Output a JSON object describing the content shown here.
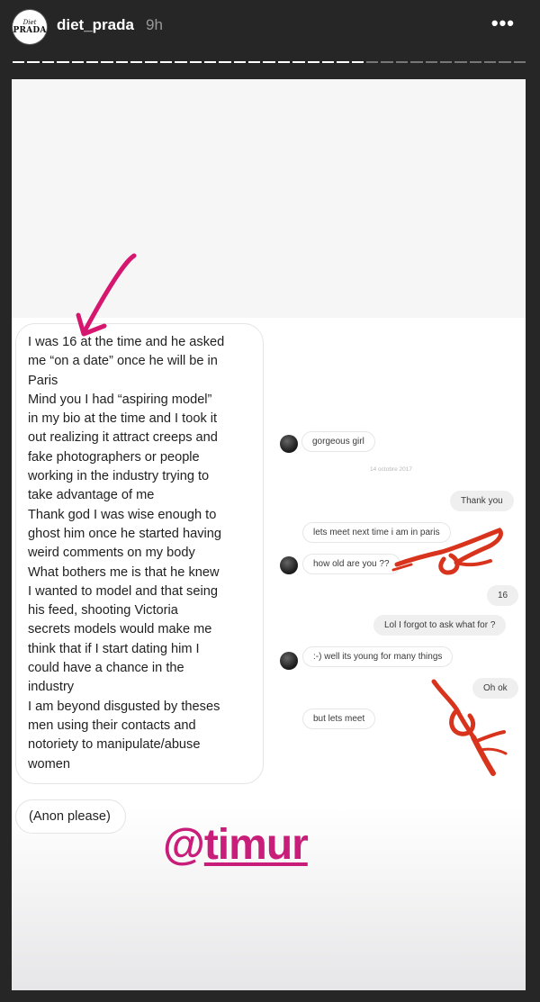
{
  "header": {
    "avatar_line1": "Diet",
    "avatar_line2": "PRADA",
    "username": "diet_prada",
    "time": "9h",
    "more_icon": "•••"
  },
  "story": {
    "message_lines": [
      "I was 16 at the time and he asked",
      "me “on a date” once he will be in",
      "Paris",
      "Mind you I had “aspiring model”",
      "in my bio at the time and I took it",
      "out realizing it attract creeps and",
      "fake photographers or people",
      "working in the industry trying to",
      "take advantage of me",
      "Thank god I was wise enough to",
      "ghost him once he started having",
      "weird comments on my body",
      "What bothers me is that he knew",
      "I wanted to model and that seing",
      "his feed, shooting Victoria",
      "secrets models would make me",
      "think that if I start dating him I",
      "could have a chance in the",
      "industry",
      "I am beyond disgusted by theses",
      "men using their contacts and",
      "notoriety to manipulate/abuse",
      "women"
    ],
    "anon_note": "(Anon please)",
    "chat": {
      "m1": "gorgeous girl",
      "date": "14 octobre 2017",
      "m2": "Thank you",
      "m3": "lets meet next time i am in paris",
      "m4": "how old are you ??",
      "m5": "16",
      "m6": "Lol I forgot to ask what for ?",
      "m7": ":-) well its young for many things",
      "m8": "Oh ok",
      "m9": "but lets meet"
    },
    "mention_prefix": "@",
    "mention_name": "timur"
  },
  "colors": {
    "arrow": "#d6176f",
    "mention": "#c81e7a",
    "emoji_red": "#d8331c"
  },
  "icons": {
    "annotation_arrow": "arrow-icon",
    "ok_hand_emoji": "ok-hand-icon"
  }
}
